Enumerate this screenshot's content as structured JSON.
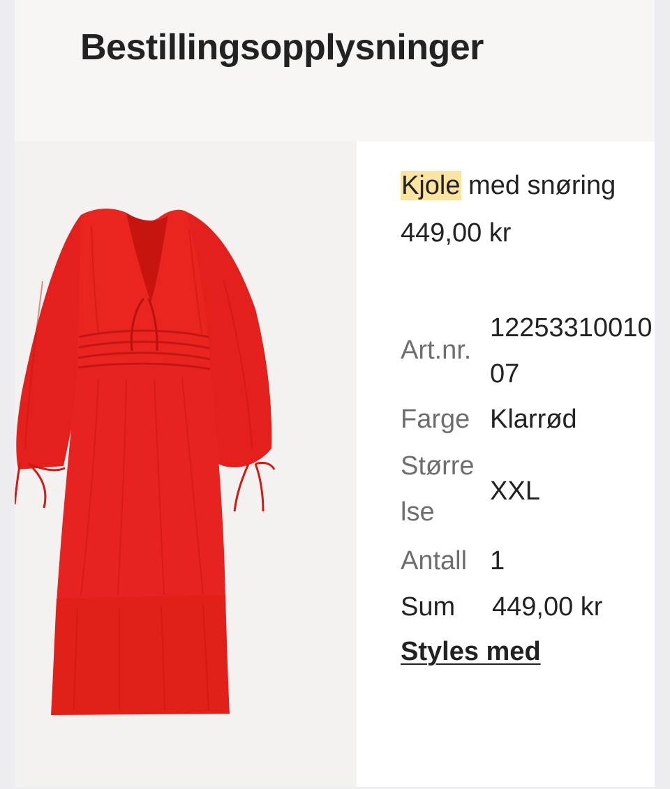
{
  "header": {
    "title": "Bestillingsopplysninger"
  },
  "product": {
    "name_highlight": "Kjole",
    "name_rest": " med snøring",
    "price": "449,00 kr",
    "image_icon": "red-dress-image",
    "details": {
      "art_label": "Art.nr.",
      "art_value": "1225331001007",
      "color_label": "Farge",
      "color_value": "Klarrød",
      "size_label": "Størrelse",
      "size_value": "XXL",
      "qty_label": "Antall",
      "qty_value": "1",
      "sum_label": "Sum",
      "sum_value": "449,00 kr"
    },
    "styles_link": "Styles med"
  },
  "colors": {
    "dress": "#e8201c",
    "highlight": "#fbe3a1"
  }
}
